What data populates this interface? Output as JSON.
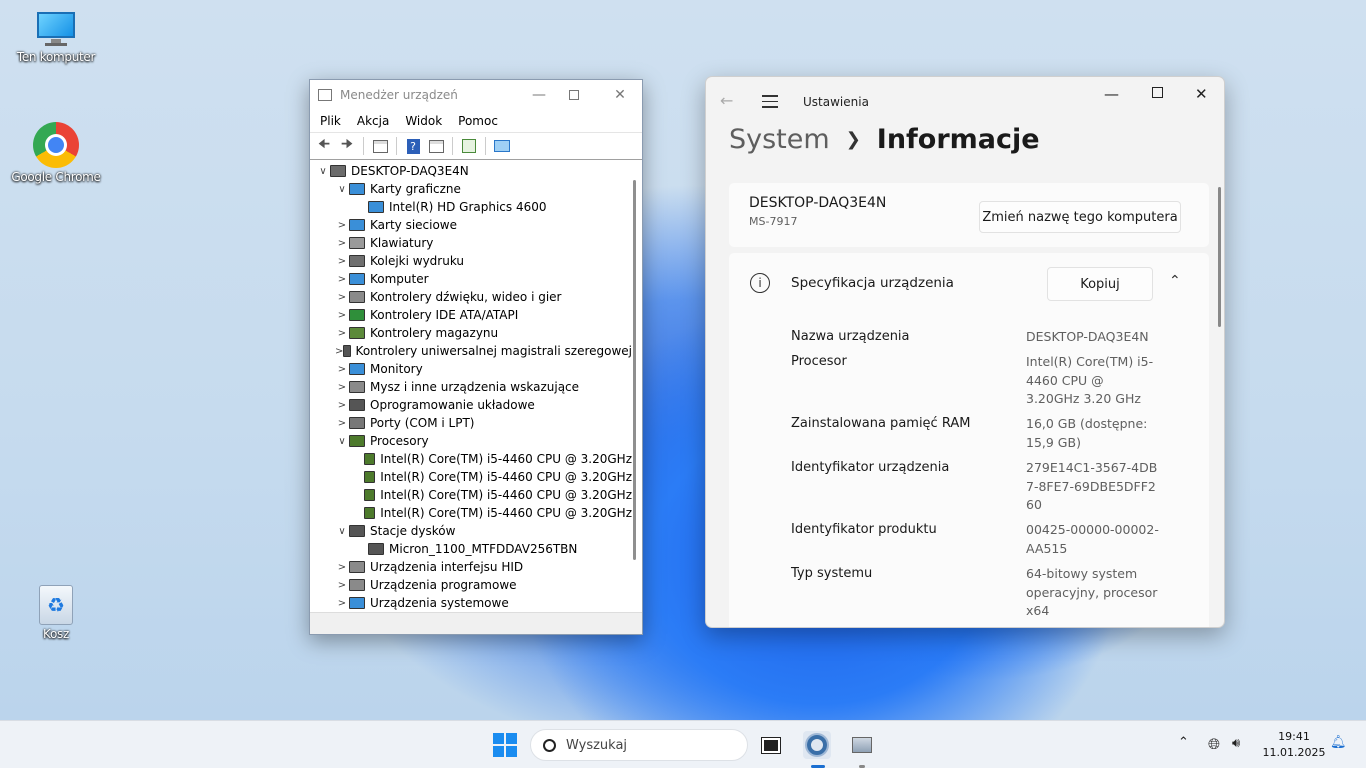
{
  "desktop": {
    "icons": [
      {
        "label": "Ten komputer"
      },
      {
        "label": "Google Chrome"
      },
      {
        "label": "Kosz"
      }
    ]
  },
  "devmgr": {
    "title": "Menedżer urządzeń",
    "menu": [
      "Plik",
      "Akcja",
      "Widok",
      "Pomoc"
    ],
    "tree": [
      {
        "level": 0,
        "label": "DESKTOP-DAQ3E4N",
        "expander": "∨",
        "color": "#6b6b6b"
      },
      {
        "level": 1,
        "label": "Karty graficzne",
        "expander": "∨",
        "color": "#3a8fd8"
      },
      {
        "level": 2,
        "label": "Intel(R) HD Graphics 4600",
        "expander": "",
        "color": "#3a8fd8"
      },
      {
        "level": 1,
        "label": "Karty sieciowe",
        "expander": ">",
        "color": "#3a8fd8"
      },
      {
        "level": 1,
        "label": "Klawiatury",
        "expander": ">",
        "color": "#9a9a9a"
      },
      {
        "level": 1,
        "label": "Kolejki wydruku",
        "expander": ">",
        "color": "#6f6f6f"
      },
      {
        "level": 1,
        "label": "Komputer",
        "expander": ">",
        "color": "#3a8fd8"
      },
      {
        "level": 1,
        "label": "Kontrolery dźwięku, wideo i gier",
        "expander": ">",
        "color": "#8a8a8a"
      },
      {
        "level": 1,
        "label": "Kontrolery IDE ATA/ATAPI",
        "expander": ">",
        "color": "#2f8f3a"
      },
      {
        "level": 1,
        "label": "Kontrolery magazynu",
        "expander": ">",
        "color": "#5c8a3a"
      },
      {
        "level": 1,
        "label": "Kontrolery uniwersalnej magistrali szeregowej",
        "expander": ">",
        "color": "#555555"
      },
      {
        "level": 1,
        "label": "Monitory",
        "expander": ">",
        "color": "#3a8fd8"
      },
      {
        "level": 1,
        "label": "Mysz i inne urządzenia wskazujące",
        "expander": ">",
        "color": "#8a8a8a"
      },
      {
        "level": 1,
        "label": "Oprogramowanie układowe",
        "expander": ">",
        "color": "#555555"
      },
      {
        "level": 1,
        "label": "Porty (COM i LPT)",
        "expander": ">",
        "color": "#777777"
      },
      {
        "level": 1,
        "label": "Procesory",
        "expander": "∨",
        "color": "#4d7a2c"
      },
      {
        "level": 2,
        "label": "Intel(R) Core(TM) i5-4460  CPU @ 3.20GHz",
        "expander": "",
        "color": "#4d7a2c"
      },
      {
        "level": 2,
        "label": "Intel(R) Core(TM) i5-4460  CPU @ 3.20GHz",
        "expander": "",
        "color": "#4d7a2c"
      },
      {
        "level": 2,
        "label": "Intel(R) Core(TM) i5-4460  CPU @ 3.20GHz",
        "expander": "",
        "color": "#4d7a2c"
      },
      {
        "level": 2,
        "label": "Intel(R) Core(TM) i5-4460  CPU @ 3.20GHz",
        "expander": "",
        "color": "#4d7a2c"
      },
      {
        "level": 1,
        "label": "Stacje dysków",
        "expander": "∨",
        "color": "#555555"
      },
      {
        "level": 2,
        "label": "Micron_1100_MTFDDAV256TBN",
        "expander": "",
        "color": "#555555"
      },
      {
        "level": 1,
        "label": "Urządzenia interfejsu HID",
        "expander": ">",
        "color": "#8a8a8a"
      },
      {
        "level": 1,
        "label": "Urządzenia programowe",
        "expander": ">",
        "color": "#8a8a8a"
      },
      {
        "level": 1,
        "label": "Urządzenia systemowe",
        "expander": ">",
        "color": "#3a8fd8"
      }
    ]
  },
  "settings": {
    "app_title": "Ustawienia",
    "crumb_parent": "System",
    "crumb_current": "Informacje",
    "pc_name": "DESKTOP-DAQ3E4N",
    "pc_model": "MS-7917",
    "rename_label": "Zmień nazwę tego komputera",
    "spec_title": "Specyfikacja urządzenia",
    "copy_label": "Kopiuj",
    "specs": [
      {
        "label": "Nazwa urządzenia",
        "value": "DESKTOP-DAQ3E4N"
      },
      {
        "label": "Procesor",
        "value": "Intel(R) Core(TM) i5-4460  CPU @ 3.20GHz   3.20 GHz"
      },
      {
        "label": "Zainstalowana pamięć RAM",
        "value": "16,0 GB (dostępne: 15,9 GB)"
      },
      {
        "label": "Identyfikator urządzenia",
        "value": "279E14C1-3567-4DB7-8FE7-69DBE5DFF260"
      },
      {
        "label": "Identyfikator produktu",
        "value": "00425-00000-00002-AA515"
      },
      {
        "label": "Typ systemu",
        "value": "64-bitowy system operacyjny, procesor x64"
      }
    ]
  },
  "taskbar": {
    "search_placeholder": "Wyszukaj",
    "time": "19:41",
    "date": "11.01.2025"
  }
}
